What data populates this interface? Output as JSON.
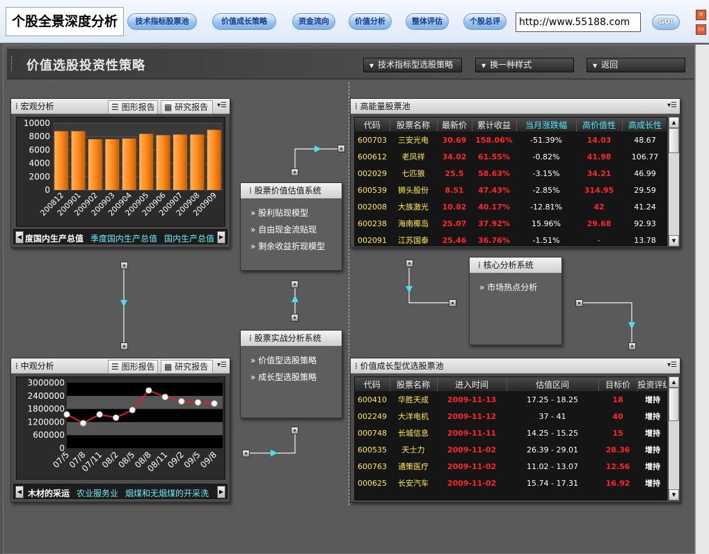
{
  "app": {
    "title": "个股全景深度分析"
  },
  "nav": [
    {
      "label": "技术指标股票池"
    },
    {
      "label": "价值成长策略"
    },
    {
      "label": "资金流向"
    },
    {
      "label": "价值分析"
    },
    {
      "label": "整体评估"
    },
    {
      "label": "个股总评"
    }
  ],
  "url": {
    "value": "http://www.55188.com",
    "go_label": "GO!"
  },
  "window": {
    "close_label": "×",
    "min_label": "▭"
  },
  "header": {
    "title": "价值选股投资性策略",
    "buttons": [
      {
        "label": "技术指标型选股策略"
      },
      {
        "label": "换一种样式"
      },
      {
        "label": "返回"
      }
    ]
  },
  "macro": {
    "title": "宏观分析",
    "tabs": [
      {
        "label": "图形报告"
      },
      {
        "label": "研究报告"
      }
    ],
    "links": [
      "度国内生产总值",
      "季度国内生产总值",
      "国内生产总值"
    ],
    "chart_data": {
      "type": "bar",
      "categories": [
        "200812",
        "200901",
        "200902",
        "200903",
        "200904",
        "200905",
        "200906",
        "200907",
        "200908",
        "200909"
      ],
      "values": [
        8800,
        8800,
        7600,
        7600,
        7700,
        8400,
        8200,
        8300,
        8300,
        9000
      ],
      "ylim": [
        0,
        10000
      ],
      "yticks": [
        0,
        2000,
        4000,
        6000,
        8000,
        10000
      ],
      "bar_color": "#ff8a1c",
      "background": "#2a2a2a"
    }
  },
  "meso": {
    "title": "中观分析",
    "tabs": [
      {
        "label": "图形报告"
      },
      {
        "label": "研究报告"
      }
    ],
    "links": [
      "木材的采运",
      "农业服务业",
      "烟煤和无烟煤的开采洗"
    ],
    "chart_data": {
      "type": "line",
      "categories": [
        "07/5",
        "07/8",
        "07/11",
        "08/2",
        "08/5",
        "08/8",
        "08/11",
        "09/2",
        "09/5",
        "09/8"
      ],
      "values": [
        1550000,
        1150000,
        1550000,
        1400000,
        1750000,
        2650000,
        2350000,
        2150000,
        2100000,
        2050000
      ],
      "ylim": [
        0,
        3000000
      ],
      "yticks": [
        0,
        600000,
        1200000,
        1800000,
        2400000,
        3000000
      ],
      "line_color": "#e02020",
      "grid": true
    }
  },
  "valuation": {
    "title": "股票价值估值系统",
    "items": [
      "股利贴现模型",
      "自由现金流贴现",
      "剩余收益折现模型"
    ]
  },
  "practice": {
    "title": "股票实战分析系统",
    "items": [
      "价值型选股策略",
      "成长型选股策略"
    ]
  },
  "core": {
    "title": "核心分析系统",
    "items": [
      "市场热点分析"
    ]
  },
  "energy_pool": {
    "title": "高能量股票池",
    "columns": [
      "代码",
      "股票名称",
      "最新价",
      "累计收益",
      "当月涨跌幅",
      "高价值性",
      "高成长性"
    ],
    "rows": [
      [
        "600703",
        "三安光电",
        "30.69",
        "158.06%",
        "-51.39%",
        "14.03",
        "48.67"
      ],
      [
        "600612",
        "老凤祥",
        "34.02",
        "61.55%",
        "-0.82%",
        "41.98",
        "106.77"
      ],
      [
        "002029",
        "七匹狼",
        "25.5",
        "58.63%",
        "-3.15%",
        "34.21",
        "46.99"
      ],
      [
        "600539",
        "狮头股份",
        "8.51",
        "47.43%",
        "-2.85%",
        "314.95",
        "29.59"
      ],
      [
        "002008",
        "大族激光",
        "10.82",
        "40.17%",
        "-12.81%",
        "42",
        "41.24"
      ],
      [
        "600238",
        "海南椰岛",
        "25.07",
        "37.92%",
        "15.96%",
        "29.68",
        "92.93"
      ],
      [
        "002091",
        "江苏国泰",
        "25.46",
        "36.76%",
        "-1.51%",
        "-",
        "13.78"
      ]
    ],
    "scroll": {
      "up": "▲",
      "down": "▼"
    }
  },
  "growth_pool": {
    "title": "价值成长型优选股票池",
    "columns": [
      "代码",
      "股票名称",
      "进入时间",
      "估值区间",
      "目标价",
      "投资评级"
    ],
    "rows": [
      [
        "600410",
        "华胜天成",
        "2009-11-13",
        "17.25 - 18.25",
        "18",
        "增持"
      ],
      [
        "002249",
        "大洋电机",
        "2009-11-12",
        "37 - 41",
        "40",
        "增持"
      ],
      [
        "000748",
        "长城信息",
        "2009-11-11",
        "14.25 - 15.25",
        "15",
        "增持"
      ],
      [
        "600535",
        "天士力",
        "2009-11-02",
        "26.39 - 29.01",
        "28.36",
        "增持"
      ],
      [
        "600763",
        "通策医疗",
        "2009-11-02",
        "11.02 - 13.07",
        "12.56",
        "增持"
      ],
      [
        "000625",
        "长安汽车",
        "2009-11-02",
        "15.74 - 17.31",
        "16.92",
        "增持"
      ]
    ],
    "scroll": {
      "up": "▲",
      "down": "▼"
    }
  },
  "colors": {
    "accent_cyan": "#53e6f8",
    "value_red": "#ff2525",
    "code_yellow": "#ffeb3b",
    "bar_orange": "#ff8a1c"
  }
}
